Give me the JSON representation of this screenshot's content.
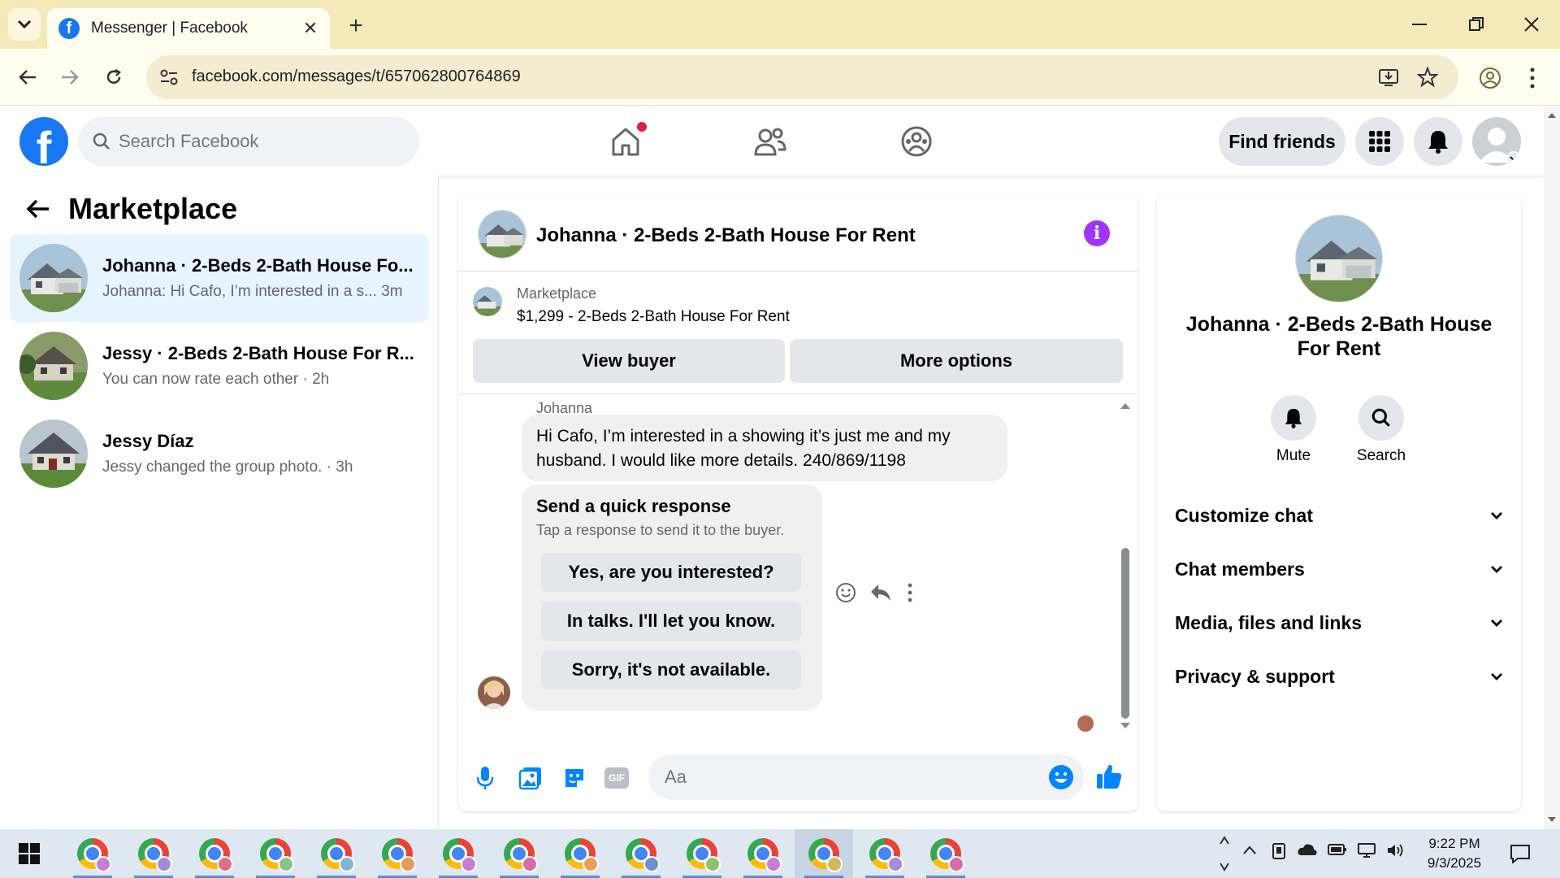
{
  "browser": {
    "tab_title": "Messenger | Facebook",
    "url": "facebook.com/messages/t/657062800764869",
    "new_tab_label": "+",
    "close_tab_label": "✕"
  },
  "fb": {
    "search_placeholder": "Search Facebook",
    "find_friends_label": "Find friends",
    "logo_letter": "f",
    "brand_color": "#1877f2"
  },
  "left": {
    "title": "Marketplace",
    "conversations": [
      {
        "name": "Johanna · 2-Beds 2-Bath House Fo...",
        "preview": "Johanna: Hi Cafo, I’m interested in a s... 3m"
      },
      {
        "name": "Jessy · 2-Beds 2-Bath House For R...",
        "preview": "You can now rate each other · 2h"
      },
      {
        "name": "Jessy Díaz",
        "preview": "Jessy changed the group photo. · 3h"
      }
    ]
  },
  "chat": {
    "title": "Johanna · 2-Beds 2-Bath House For Rent",
    "listing_label": "Marketplace",
    "listing_title": "$1,299 - 2-Beds 2-Bath House For Rent",
    "view_buyer_label": "View buyer",
    "more_options_label": "More options",
    "sender_name": "Johanna",
    "message_line1": "Hi Cafo, I’m interested in a showing it’s just me and my",
    "message_line2": "husband. I would like more details. 240/869/1198",
    "quick_title": "Send a quick response",
    "quick_subtitle": "Tap a response to send it to the buyer.",
    "quick_responses": [
      "Yes, are you interested?",
      "In talks. I'll let you know.",
      "Sorry, it's not available."
    ],
    "input_placeholder": "Aa"
  },
  "info": {
    "name_line1": "Johanna · 2-Beds 2-Bath House",
    "name_line2": "For Rent",
    "mute_label": "Mute",
    "search_label": "Search",
    "rows": [
      "Customize chat",
      "Chat members",
      "Media, files and links",
      "Privacy & support"
    ]
  },
  "taskbar": {
    "time": "9:22 PM",
    "date": "9/3/2025"
  },
  "colors": {
    "accent_purple": "#a033ff",
    "messenger_blue": "#0084ff",
    "notification_red": "#e41e3f"
  }
}
